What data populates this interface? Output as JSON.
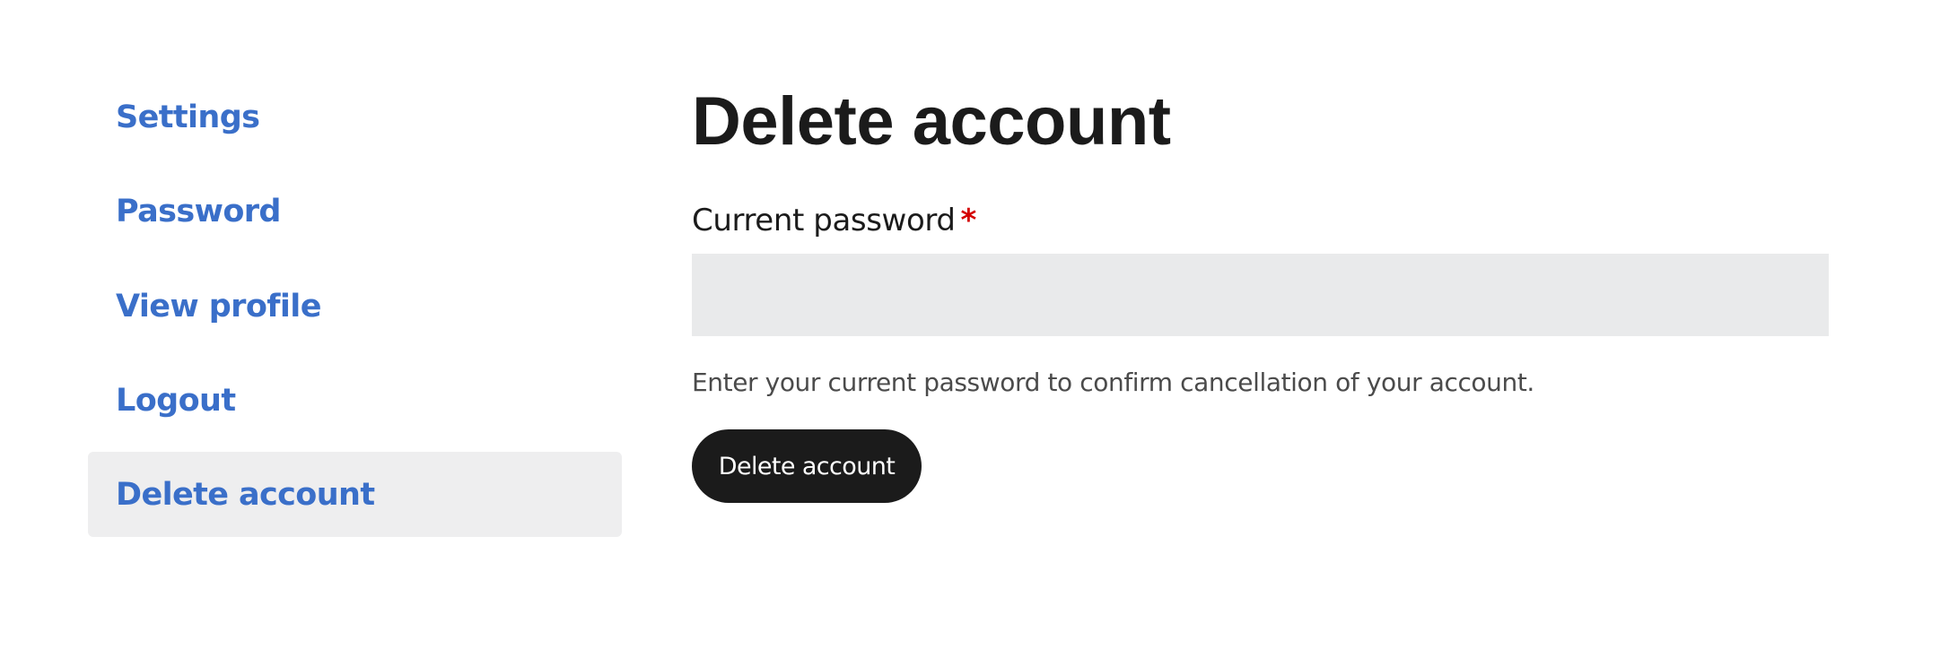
{
  "sidebar": {
    "items": [
      {
        "label": "Settings",
        "active": false
      },
      {
        "label": "Password",
        "active": false
      },
      {
        "label": "View profile",
        "active": false
      },
      {
        "label": "Logout",
        "active": false
      },
      {
        "label": "Delete account",
        "active": true
      }
    ]
  },
  "main": {
    "title": "Delete account",
    "form": {
      "password_label": "Current password",
      "required_marker": "*",
      "password_value": "",
      "help_text": "Enter your current password to confirm cancellation of your account.",
      "submit_label": "Delete account"
    }
  },
  "colors": {
    "link": "#3a6fc9",
    "active_bg": "#eeeeef",
    "input_bg": "#e9eaeb",
    "required": "#d40000",
    "button_bg": "#1b1b1b",
    "text": "#1b1b1b"
  }
}
